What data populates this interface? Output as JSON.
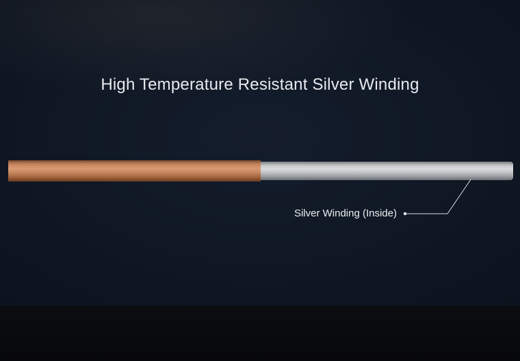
{
  "headline": "High Temperature Resistant Silver Winding",
  "callout": {
    "label": "Silver Winding (Inside)"
  },
  "colors": {
    "copper": "#c98a63",
    "silver": "#c8cacc",
    "background": "#111a27"
  }
}
